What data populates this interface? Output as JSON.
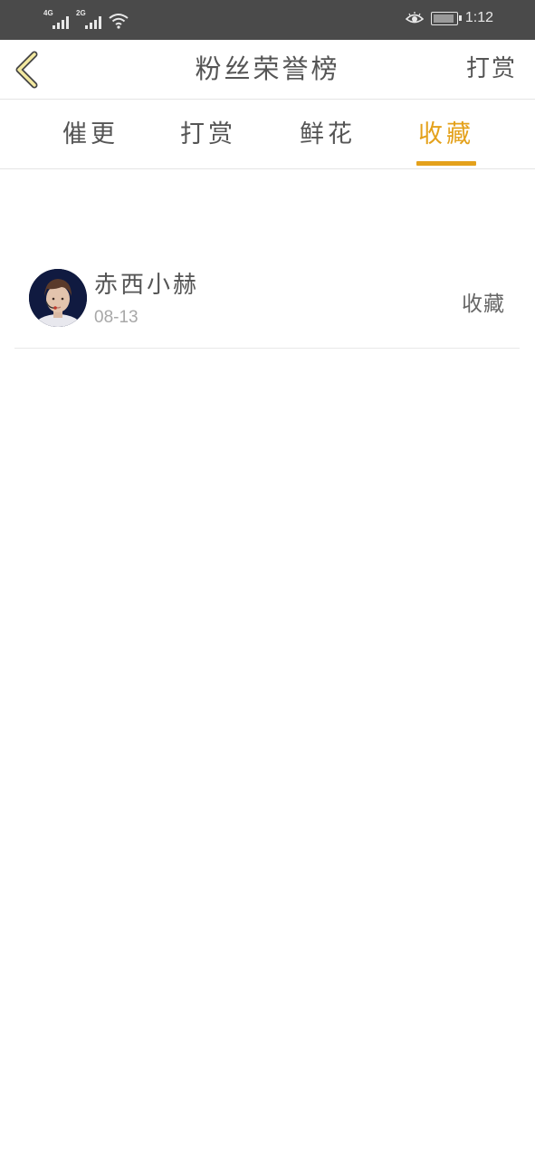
{
  "status_bar": {
    "signal1_tag": "4G",
    "signal2_tag": "2G",
    "time": "1:12"
  },
  "nav": {
    "title": "粉丝荣誉榜",
    "action": "打赏"
  },
  "tabs": [
    {
      "label": "催更",
      "active": false
    },
    {
      "label": "打赏",
      "active": false
    },
    {
      "label": "鲜花",
      "active": false
    },
    {
      "label": "收藏",
      "active": true
    }
  ],
  "list": [
    {
      "name": "赤西小赫",
      "date": "08-13",
      "action": "收藏"
    }
  ],
  "colors": {
    "accent": "#e4a11b",
    "status_bar": "#4a4a4a",
    "text": "#555555",
    "muted": "#a8a8a8"
  }
}
